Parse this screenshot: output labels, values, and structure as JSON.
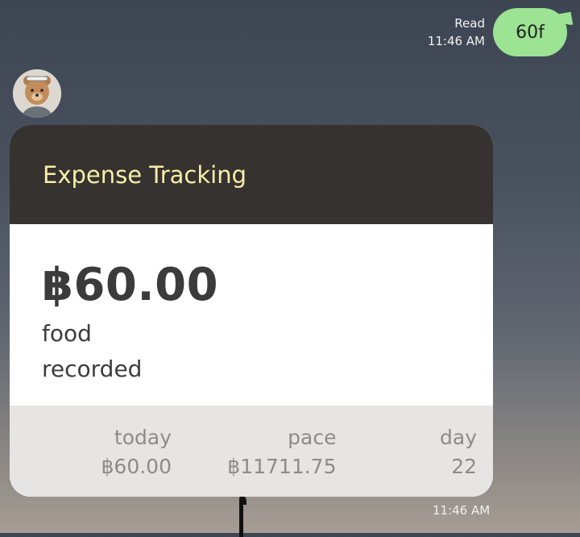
{
  "sent_message": {
    "read_label": "Read",
    "time": "11:46 AM",
    "text": "60f"
  },
  "card": {
    "title": "Expense Tracking",
    "amount": "฿60.00",
    "category": "food",
    "status": "recorded",
    "stats": [
      {
        "label": "today",
        "value": "฿60.00"
      },
      {
        "label": "pace",
        "value": "฿11711.75"
      },
      {
        "label": "day",
        "value": "22"
      }
    ]
  },
  "received_time": "11:46 AM",
  "colors": {
    "sent_bubble": "#9ce394",
    "card_header": "#353230",
    "card_title": "#f8eea6",
    "card_footer": "#e6e5e3"
  }
}
